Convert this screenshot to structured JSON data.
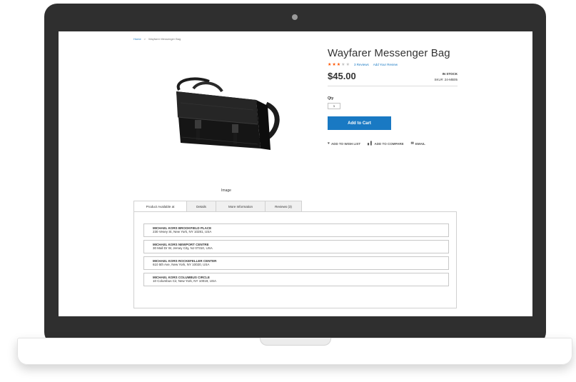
{
  "breadcrumb": {
    "home": "Home",
    "separator": ">",
    "current": "Wayfarer Messenger Bag"
  },
  "product": {
    "title": "Wayfarer Messenger Bag",
    "rating": 3,
    "rating_max": 5,
    "reviews_link": "3  Reviews",
    "add_review_link": "Add Your Review",
    "price": "$45.00",
    "stock": "IN STOCK",
    "sku": "SKU#:  24-MB05"
  },
  "gallery": {
    "caption": "Image"
  },
  "cart": {
    "qty_label": "Qty",
    "qty_value": "1",
    "add_to_cart_label": "Add to Cart"
  },
  "actions": {
    "wishlist": "ADD TO WISH LIST",
    "compare": "ADD TO COMPARE",
    "email": "EMAIL"
  },
  "tabs": [
    {
      "label": "Product Available at",
      "active": true
    },
    {
      "label": "Details",
      "active": false
    },
    {
      "label": "More Information",
      "active": false
    },
    {
      "label": "Reviews (3)",
      "active": false
    }
  ],
  "stores": [
    {
      "name": "MICHAEL KORS BROOKFIELD PLACE",
      "address": "230 Vesey St, New York, NY 10281, USA"
    },
    {
      "name": "MICHAEL KORS NEWPORT CENTRE",
      "address": "30 Mall Dr W, Jersey City, NJ 07310, USA"
    },
    {
      "name": "MICHAEL KORS ROCKEFELLER CENTER",
      "address": "610 5th Ave, New York, NY 10020, USA"
    },
    {
      "name": "MICHAEL KORS COLUMBUS CIRCLE",
      "address": "10 Columbus Cir, New York, NY 10019, USA"
    }
  ],
  "colors": {
    "accent": "#1979c3",
    "star": "#ff5501",
    "laptop_frame": "#2f2f2f"
  },
  "icons": {
    "wishlist": "heart-icon",
    "compare": "bar-chart-icon",
    "email": "envelope-icon"
  }
}
